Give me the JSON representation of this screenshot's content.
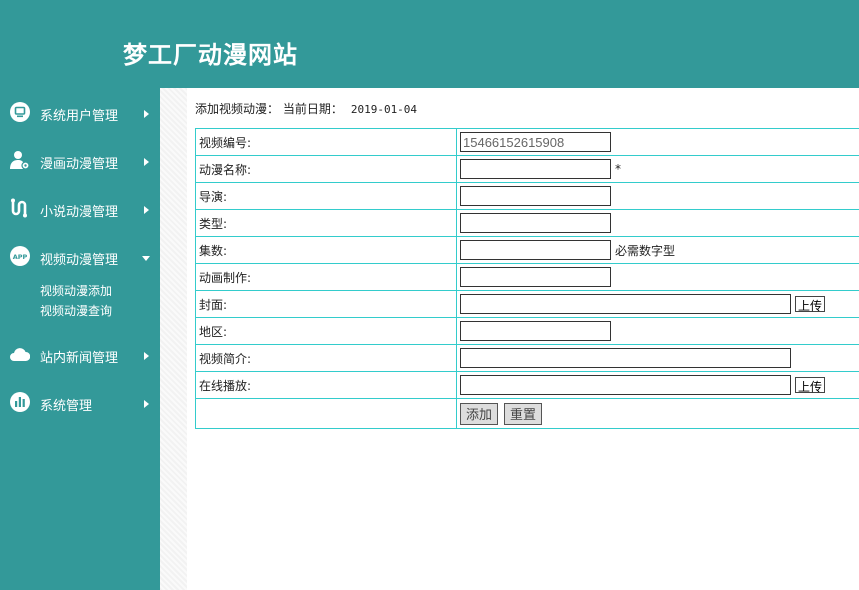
{
  "site": {
    "title": "梦工厂动漫网站"
  },
  "sidebar": {
    "items": [
      {
        "label": "系统用户管理",
        "icon": "monitor-icon"
      },
      {
        "label": "漫画动漫管理",
        "icon": "user-gear-icon"
      },
      {
        "label": "小说动漫管理",
        "icon": "route-icon"
      },
      {
        "label": "视频动漫管理",
        "icon": "app-icon",
        "expanded": true,
        "children": [
          {
            "label": "视频动漫添加"
          },
          {
            "label": "视频动漫查询"
          }
        ]
      },
      {
        "label": "站内新闻管理",
        "icon": "cloud-icon"
      },
      {
        "label": "系统管理",
        "icon": "bar-chart-icon"
      }
    ]
  },
  "breadcrumb": {
    "text": "添加视频动漫：  当前日期：",
    "date": "2019-01-04"
  },
  "form": {
    "video_no": {
      "label": "视频编号:",
      "value": "15466152615908"
    },
    "name": {
      "label": "动漫名称:",
      "value": "",
      "required_mark": "*"
    },
    "director": {
      "label": "导演:",
      "value": ""
    },
    "type": {
      "label": "类型:",
      "value": ""
    },
    "episodes": {
      "label": "集数:",
      "value": "",
      "hint": "必需数字型"
    },
    "producer": {
      "label": "动画制作:",
      "value": ""
    },
    "cover": {
      "label": "封面:",
      "value": "",
      "upload_label": "上传"
    },
    "region": {
      "label": "地区:",
      "value": ""
    },
    "intro": {
      "label": "视频简介:",
      "value": ""
    },
    "play": {
      "label": "在线播放:",
      "value": "",
      "upload_label": "上传"
    },
    "add_label": "添加",
    "reset_label": "重置"
  },
  "colors": {
    "teal": "#339999",
    "border": "#33cccc"
  }
}
